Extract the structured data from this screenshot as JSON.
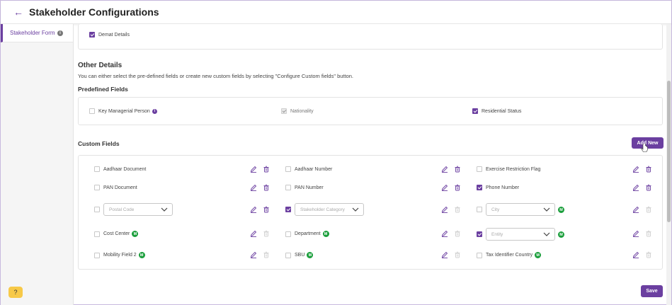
{
  "header": {
    "title": "Stakeholder Configurations"
  },
  "sidebar": {
    "items": [
      {
        "label": "Stakeholder Form"
      }
    ]
  },
  "demat": {
    "label": "Demat Details",
    "checked": true
  },
  "other_details": {
    "title": "Other Details",
    "description": "You can either select the pre-defined fields or create new custom fields by selecting \"Configure Custom fields\" button."
  },
  "predefined": {
    "title": "Predefined Fields",
    "fields": [
      {
        "label": "Key Managerial Person",
        "checked": false,
        "info": true
      },
      {
        "label": "Nationality",
        "checked": true,
        "disabled": true
      },
      {
        "label": "Residential Status",
        "checked": true
      }
    ]
  },
  "custom": {
    "title": "Custom Fields",
    "add_label": "Add New",
    "rows": [
      [
        {
          "label": "Aadhaar Document",
          "checked": false
        },
        {
          "label": "Aadhaar Number",
          "checked": false
        },
        {
          "label": "Exercise Restriction Flag",
          "checked": false
        }
      ],
      [
        {
          "label": "PAN Document",
          "checked": false
        },
        {
          "label": "PAN Number",
          "checked": false
        },
        {
          "label": "Phone Number",
          "checked": true
        }
      ],
      [
        {
          "placeholder": "Postal Code",
          "checked": false
        },
        {
          "placeholder": "Stakeholder Category",
          "checked": true
        },
        {
          "placeholder": "City",
          "checked": false,
          "mandatory": true
        }
      ],
      [
        {
          "label": "Cost Center",
          "checked": false,
          "mandatory": true
        },
        {
          "label": "Department",
          "checked": false,
          "mandatory": true
        },
        {
          "placeholder": "Entity",
          "checked": true,
          "mandatory": true
        }
      ],
      [
        {
          "label": "Mobility Field 2",
          "checked": false,
          "mandatory": true
        },
        {
          "label": "SBU",
          "checked": false,
          "mandatory": true
        },
        {
          "label": "Tax Identifier Country",
          "checked": false,
          "mandatory": true
        }
      ]
    ],
    "badge": "M"
  },
  "footer": {
    "save_label": "Save"
  },
  "colors": {
    "accent": "#6b3fa0",
    "mandatory": "#1a9e3b",
    "help": "#f7c948"
  }
}
